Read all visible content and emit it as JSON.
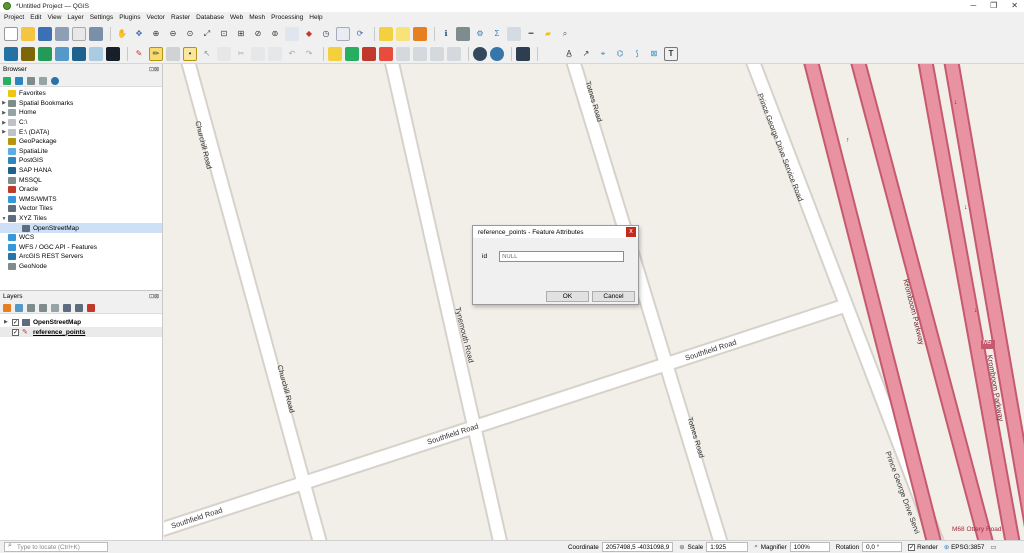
{
  "window": {
    "title": "*Untitled Project — QGIS",
    "minimize": "─",
    "restore": "❐",
    "close": "✕"
  },
  "menu": [
    "Project",
    "Edit",
    "View",
    "Layer",
    "Settings",
    "Plugins",
    "Vector",
    "Raster",
    "Database",
    "Web",
    "Mesh",
    "Processing",
    "Help"
  ],
  "browser": {
    "title": "Browser",
    "close": "⊡⊠",
    "items": [
      {
        "label": "Favorites",
        "icon": "star-icon",
        "arrow": "",
        "color": "#f1c40f"
      },
      {
        "label": "Spatial Bookmarks",
        "icon": "bookmark-icon",
        "arrow": "▶",
        "color": "#7f8c8d"
      },
      {
        "label": "Home",
        "icon": "home-folder-icon",
        "arrow": "▶",
        "color": "#95a5a6"
      },
      {
        "label": "C:\\",
        "icon": "drive-icon",
        "arrow": "▶",
        "color": "#bdc3c7"
      },
      {
        "label": "E:\\ (DATA)",
        "icon": "drive-icon",
        "arrow": "▶",
        "color": "#bdc3c7"
      },
      {
        "label": "GeoPackage",
        "icon": "geopackage-icon",
        "arrow": "",
        "color": "#b7950b"
      },
      {
        "label": "SpatiaLite",
        "icon": "spatialite-icon",
        "arrow": "",
        "color": "#5dade2"
      },
      {
        "label": "PostGIS",
        "icon": "postgis-icon",
        "arrow": "",
        "color": "#2e86c1"
      },
      {
        "label": "SAP HANA",
        "icon": "sap-hana-icon",
        "arrow": "",
        "color": "#1f618d"
      },
      {
        "label": "MSSQL",
        "icon": "mssql-icon",
        "arrow": "",
        "color": "#7f8c8d"
      },
      {
        "label": "Oracle",
        "icon": "oracle-icon",
        "arrow": "",
        "color": "#c0392b"
      },
      {
        "label": "WMS/WMTS",
        "icon": "wms-icon",
        "arrow": "",
        "color": "#3498db"
      },
      {
        "label": "Vector Tiles",
        "icon": "vector-tiles-icon",
        "arrow": "",
        "color": "#5d6d7e"
      },
      {
        "label": "XYZ Tiles",
        "icon": "xyz-tiles-icon",
        "arrow": "▼",
        "color": "#5d6d7e"
      },
      {
        "label": "OpenStreetMap",
        "icon": "grid-icon",
        "arrow": "",
        "color": "#5d6d7e",
        "child": true,
        "selected": true
      },
      {
        "label": "WCS",
        "icon": "wcs-icon",
        "arrow": "",
        "color": "#3498db"
      },
      {
        "label": "WFS / OGC API - Features",
        "icon": "wfs-icon",
        "arrow": "",
        "color": "#3498db"
      },
      {
        "label": "ArcGIS REST Servers",
        "icon": "arcgis-icon",
        "arrow": "",
        "color": "#2874a6"
      },
      {
        "label": "GeoNode",
        "icon": "geonode-icon",
        "arrow": "",
        "color": "#7f8c8d"
      }
    ]
  },
  "layers": {
    "title": "Layers",
    "close": "⊡⊠",
    "items": [
      {
        "label": "OpenStreetMap",
        "checked": "✓",
        "arrow": "▶"
      },
      {
        "label": "reference_points",
        "checked": "✓",
        "arrow": ""
      }
    ]
  },
  "map": {
    "roads": [
      {
        "label": "Churchill Road"
      },
      {
        "label": "Churchill Road"
      },
      {
        "label": "Totnes Road"
      },
      {
        "label": "Prince George Drive Service Road"
      },
      {
        "label": "Tynemouth Road"
      },
      {
        "label": "Southfield Road"
      },
      {
        "label": "Southfield Road"
      },
      {
        "label": "Southfield Road"
      },
      {
        "label": "Totnes Road"
      },
      {
        "label": "Kromboom Parkway"
      },
      {
        "label": "Kromboom Parkway"
      },
      {
        "label": "Prince George Drive Servi"
      },
      {
        "label": "M5"
      },
      {
        "label": "M68 Ottery Road"
      }
    ]
  },
  "dialog": {
    "title": "reference_points - Feature Attributes",
    "close": "x",
    "field_label": "id",
    "field_placeholder": "NULL",
    "ok": "OK",
    "cancel": "Cancel"
  },
  "status": {
    "locate_placeholder": "Type to locate (Ctrl+K)",
    "coordinate_label": "Coordinate",
    "coordinate_value": "2057498,5 -4031098,9",
    "scale_label": "Scale",
    "scale_value": "1:925",
    "magnifier_label": "Magnifier",
    "magnifier_value": "100%",
    "rotation_label": "Rotation",
    "rotation_value": "0,0 °",
    "render_label": "Render",
    "crs_value": "EPSG:3857"
  }
}
